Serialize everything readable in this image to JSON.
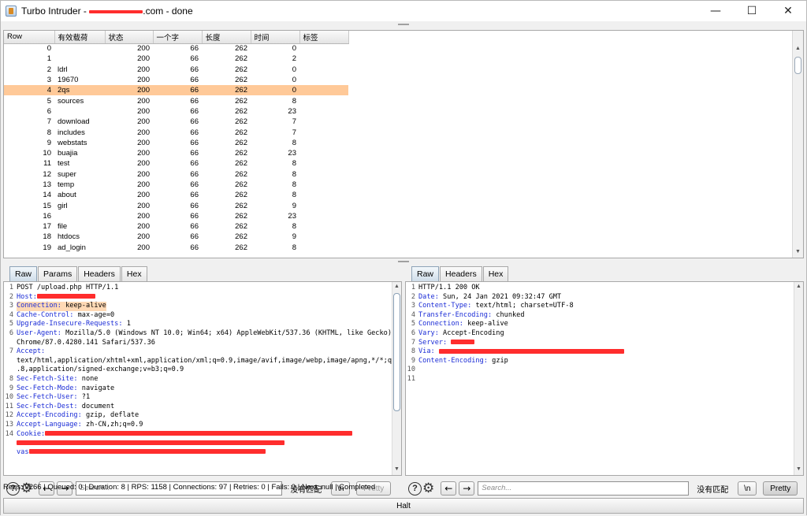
{
  "window": {
    "title_prefix": "Turbo Intruder - ",
    "title_suffix": ".com - done",
    "minimize_glyph": "—",
    "maximize_glyph": "☐",
    "close_glyph": "✕"
  },
  "table": {
    "columns": [
      "Row",
      "有效载荷",
      "状态",
      "一个字",
      "长度",
      "时间",
      "标签"
    ],
    "selected_row": 4,
    "rows": [
      [
        "0",
        "",
        "200",
        "66",
        "262",
        "0",
        ""
      ],
      [
        "1",
        "",
        "200",
        "66",
        "262",
        "2",
        ""
      ],
      [
        "2",
        "ldrl",
        "200",
        "66",
        "262",
        "0",
        ""
      ],
      [
        "3",
        "19670",
        "200",
        "66",
        "262",
        "0",
        ""
      ],
      [
        "4",
        "2qs",
        "200",
        "66",
        "262",
        "0",
        ""
      ],
      [
        "5",
        "sources",
        "200",
        "66",
        "262",
        "8",
        ""
      ],
      [
        "6",
        "",
        "200",
        "66",
        "262",
        "23",
        ""
      ],
      [
        "7",
        "download",
        "200",
        "66",
        "262",
        "7",
        ""
      ],
      [
        "8",
        "includes",
        "200",
        "66",
        "262",
        "7",
        ""
      ],
      [
        "9",
        "webstats",
        "200",
        "66",
        "262",
        "8",
        ""
      ],
      [
        "10",
        "buajia",
        "200",
        "66",
        "262",
        "23",
        ""
      ],
      [
        "11",
        "test",
        "200",
        "66",
        "262",
        "8",
        ""
      ],
      [
        "12",
        "super",
        "200",
        "66",
        "262",
        "8",
        ""
      ],
      [
        "13",
        "temp",
        "200",
        "66",
        "262",
        "8",
        ""
      ],
      [
        "14",
        "about",
        "200",
        "66",
        "262",
        "8",
        ""
      ],
      [
        "15",
        "girl",
        "200",
        "66",
        "262",
        "9",
        ""
      ],
      [
        "16",
        "",
        "200",
        "66",
        "262",
        "23",
        ""
      ],
      [
        "17",
        "file",
        "200",
        "66",
        "262",
        "8",
        ""
      ],
      [
        "18",
        "htdocs",
        "200",
        "66",
        "262",
        "9",
        ""
      ],
      [
        "19",
        "ad_login",
        "200",
        "66",
        "262",
        "8",
        ""
      ]
    ]
  },
  "request": {
    "tabs": [
      "Raw",
      "Params",
      "Headers",
      "Hex"
    ],
    "lines": [
      {
        "n": "1",
        "key": "",
        "val": "POST /upload.php HTTP/1.1"
      },
      {
        "n": "2",
        "key": "Host:",
        "val": "",
        "redact": 74
      },
      {
        "n": "3",
        "key": "Connection:",
        "val": " keep-alive",
        "highlight": true
      },
      {
        "n": "4",
        "key": "Cache-Control:",
        "val": " max-age=0"
      },
      {
        "n": "5",
        "key": "Upgrade-Insecure-Requests:",
        "val": " 1"
      },
      {
        "n": "6",
        "key": "User-Agent:",
        "val": " Mozilla/5.0 (Windows NT 10.0; Win64; x64) AppleWebKit/537.36 (KHTML, like Gecko)"
      },
      {
        "n": "",
        "key": "",
        "val": "Chrome/87.0.4280.141 Safari/537.36"
      },
      {
        "n": "7",
        "key": "Accept:",
        "val": ""
      },
      {
        "n": "",
        "key": "",
        "val": "text/html,application/xhtml+xml,application/xml;q=0.9,image/avif,image/webp,image/apng,*/*;q=0"
      },
      {
        "n": "",
        "key": "",
        "val": ".8,application/signed-exchange;v=b3;q=0.9"
      },
      {
        "n": "8",
        "key": "Sec-Fetch-Site:",
        "val": " none"
      },
      {
        "n": "9",
        "key": "Sec-Fetch-Mode:",
        "val": " navigate"
      },
      {
        "n": "10",
        "key": "Sec-Fetch-User:",
        "val": " ?1"
      },
      {
        "n": "11",
        "key": "Sec-Fetch-Dest:",
        "val": " document"
      },
      {
        "n": "12",
        "key": "Accept-Encoding:",
        "val": " gzip, deflate"
      },
      {
        "n": "13",
        "key": "Accept-Language:",
        "val": " zh-CN,zh;q=0.9"
      },
      {
        "n": "14",
        "key": "Cookie:",
        "val": "",
        "redact": 390
      },
      {
        "n": "",
        "key": "",
        "val": "",
        "redact": 340
      },
      {
        "n": "",
        "key": "vas",
        "val": "",
        "redact": 300
      }
    ],
    "search_placeholder": "Search...",
    "match_label": "没有匹配",
    "newline_label": "\\n",
    "pretty_label": "Pretty"
  },
  "response": {
    "tabs": [
      "Raw",
      "Headers",
      "Hex"
    ],
    "lines": [
      {
        "n": "1",
        "key": "",
        "val": "HTTP/1.1 200 OK"
      },
      {
        "n": "2",
        "key": "Date:",
        "val": " Sun, 24 Jan 2021 09:32:47 GMT"
      },
      {
        "n": "3",
        "key": "Content-Type:",
        "val": " text/html; charset=UTF-8"
      },
      {
        "n": "4",
        "key": "Transfer-Encoding:",
        "val": " chunked"
      },
      {
        "n": "5",
        "key": "Connection:",
        "val": " keep-alive"
      },
      {
        "n": "6",
        "key": "Vary:",
        "val": " Accept-Encoding"
      },
      {
        "n": "7",
        "key": "Server:",
        "val": " ",
        "redact": 30
      },
      {
        "n": "8",
        "key": "Via:",
        "val": " ",
        "redact": 235
      },
      {
        "n": "9",
        "key": "Content-Encoding:",
        "val": " gzip"
      },
      {
        "n": "10",
        "key": "",
        "val": ""
      },
      {
        "n": "11",
        "key": "",
        "val": ""
      }
    ],
    "search_placeholder": "Search...",
    "match_label": "没有匹配",
    "newline_label": "\\n",
    "pretty_label": "Pretty"
  },
  "status": {
    "text": "Reqs: 9266 | Queued: 0 | Duration: 8 | RPS: 1158 | Connections: 97 | Retries: 0 | Fails: 0 | Next: null | Completed"
  },
  "halt_label": "Halt",
  "icons": {
    "help": "?",
    "settings": "⚙",
    "prev": "←",
    "next": "→"
  }
}
